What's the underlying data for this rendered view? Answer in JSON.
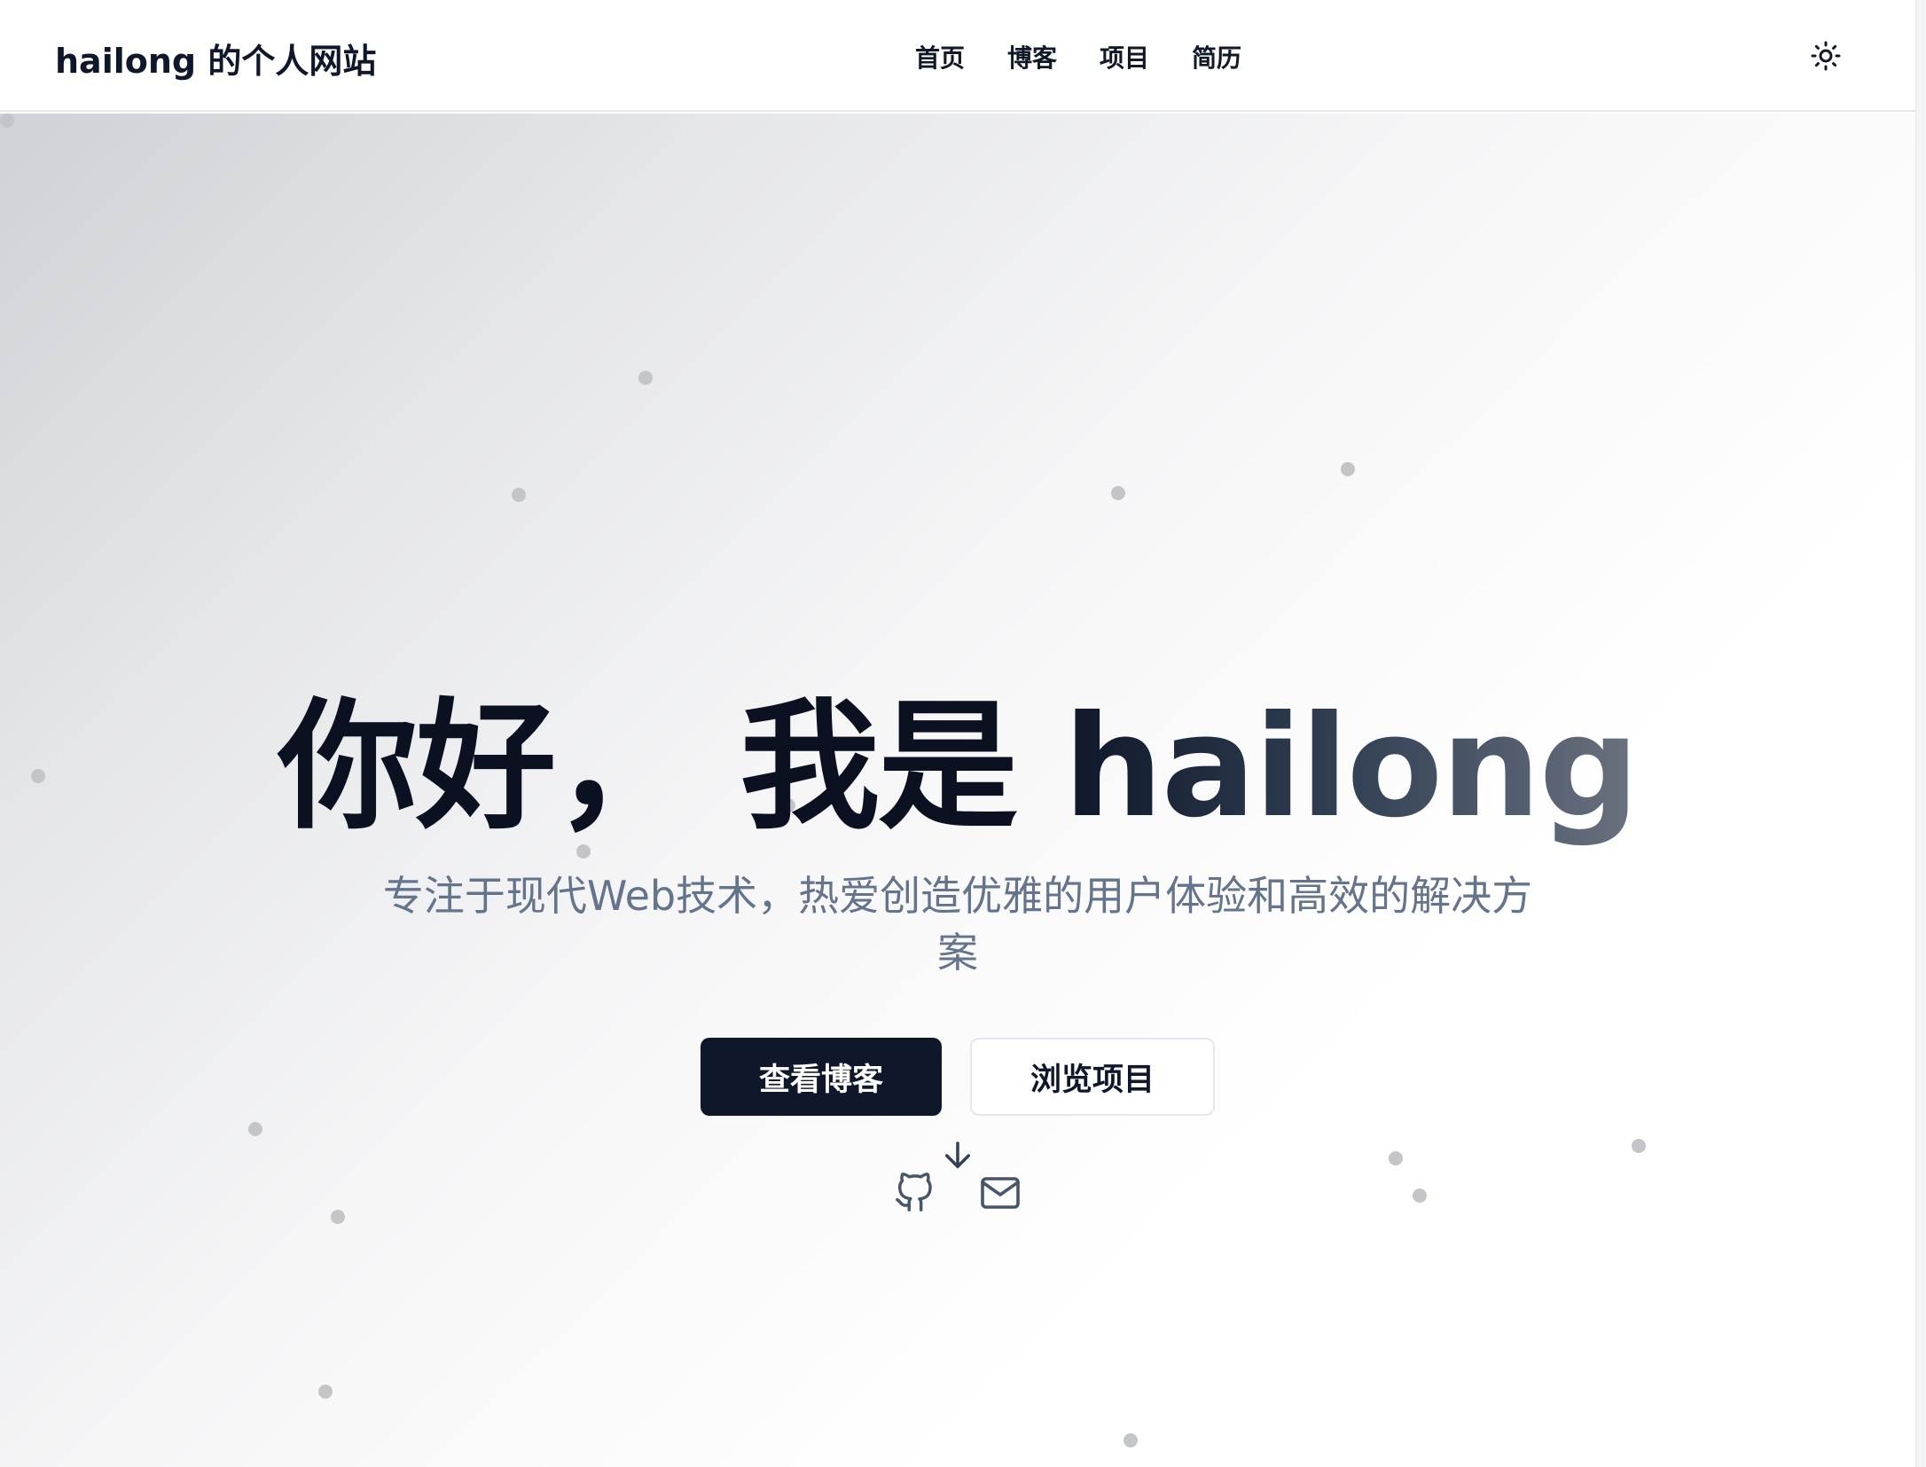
{
  "header": {
    "site_title": "hailong 的个人网站",
    "nav": [
      "首页",
      "博客",
      "项目",
      "简历"
    ],
    "theme_icon": "sun-icon"
  },
  "hero": {
    "greeting": "你好， 我是 ",
    "name": "hailong",
    "subtitle": "专注于现代Web技术，热爱创造优雅的用户体验和高效的解决方案",
    "primary_button": "查看博客",
    "secondary_button": "浏览项目",
    "icons": [
      "arrow-down-icon",
      "github-icon",
      "mail-icon"
    ]
  },
  "colors": {
    "primary": "#0f172a",
    "muted": "#64748b",
    "dot": "#c4c5c9"
  }
}
